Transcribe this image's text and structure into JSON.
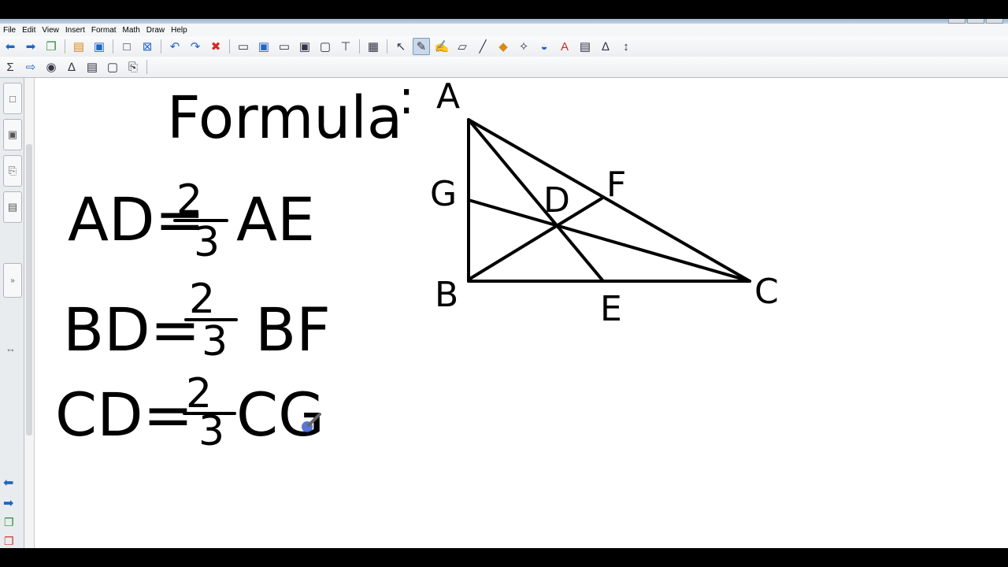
{
  "menu": [
    "File",
    "Edit",
    "View",
    "Insert",
    "Format",
    "Math",
    "Draw",
    "Help"
  ],
  "board": {
    "heading": "Formula",
    "colon": ":",
    "formulas": [
      {
        "lhs": "AD=",
        "num": "2",
        "den": "3",
        "rhs": "AE"
      },
      {
        "lhs": "BD=",
        "num": "2",
        "den": "3",
        "rhs": "BF"
      },
      {
        "lhs": "CD=",
        "num": "2",
        "den": "3",
        "rhs": "CG"
      }
    ],
    "vertices": [
      "A",
      "B",
      "C",
      "D",
      "E",
      "F",
      "G"
    ]
  },
  "icons": {
    "toolbar1": [
      "back-arrow-icon",
      "forward-arrow-icon",
      "add-page-icon",
      "open-folder-icon",
      "save-icon",
      "paste-icon",
      "delete-page-icon",
      "undo-icon",
      "redo-icon",
      "delete-icon",
      "screen-shade-icon",
      "show-screen-icon",
      "capture-icon",
      "full-screen-icon",
      "capture-area-icon",
      "capture-window-icon",
      "table-icon",
      "select-icon",
      "pen-icon",
      "creative-pen-icon",
      "eraser-icon",
      "line-icon",
      "shapes-icon",
      "magic-pen-icon",
      "fill-icon",
      "text-icon",
      "properties-icon",
      "pen-style-icon",
      "move-toolbar-icon"
    ],
    "toolbar2": [
      "sigma-icon",
      "arrow-shape-icon",
      "highlighter-icon",
      "handwriting-recognition-icon",
      "table-format-icon",
      "measure-icon",
      "attach-icon"
    ]
  },
  "colors": {
    "accent": "#1f65c6",
    "ink": "#000000"
  }
}
